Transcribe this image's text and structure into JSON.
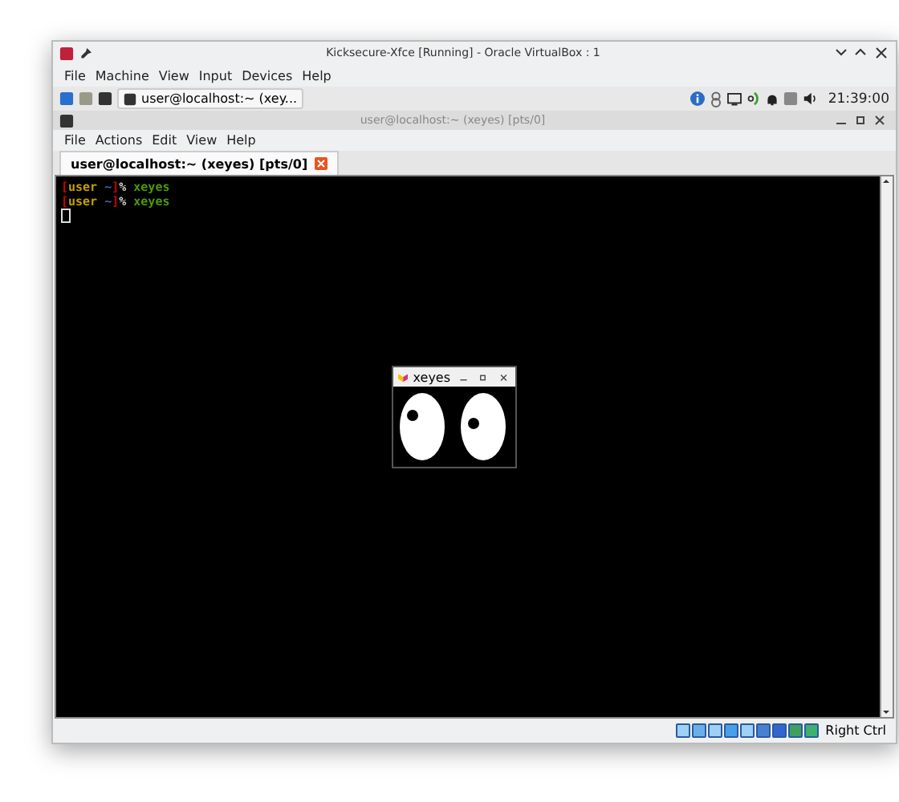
{
  "window": {
    "title": "Kicksecure-Xfce [Running] - Oracle VirtualBox : 1"
  },
  "menu": [
    "File",
    "Machine",
    "View",
    "Input",
    "Devices",
    "Help"
  ],
  "panel": {
    "task": "user@localhost:~ (xey...",
    "clock": "21:39:00"
  },
  "terminal": {
    "title": "user@localhost:~ (xeyes) [pts/0]",
    "menu": [
      "File",
      "Actions",
      "Edit",
      "View",
      "Help"
    ],
    "tabs": [
      {
        "label": "user@localhost:~ (xeyes) [pts/0]",
        "selected": true
      }
    ],
    "lines": [
      [
        {
          "text": "[",
          "color": "#cc0000"
        },
        {
          "text": "user",
          "color": "#c4a000"
        },
        {
          "text": " ~",
          "color": "#3465a4"
        },
        {
          "text": "]",
          "color": "#cc0000"
        },
        {
          "text": "%",
          "color": "#d3d7cf"
        },
        {
          "text": " xeyes",
          "color": "#4e9a06"
        }
      ],
      [
        {
          "text": "[",
          "color": "#cc0000"
        },
        {
          "text": "user",
          "color": "#c4a000"
        },
        {
          "text": " ~",
          "color": "#3465a4"
        },
        {
          "text": "]",
          "color": "#cc0000"
        },
        {
          "text": "%",
          "color": "#d3d7cf"
        },
        {
          "text": " xeyes",
          "color": "#4e9a06"
        }
      ]
    ]
  },
  "xeyes": {
    "title": "xeyes"
  },
  "status": {
    "host_key": "Right Ctrl"
  }
}
